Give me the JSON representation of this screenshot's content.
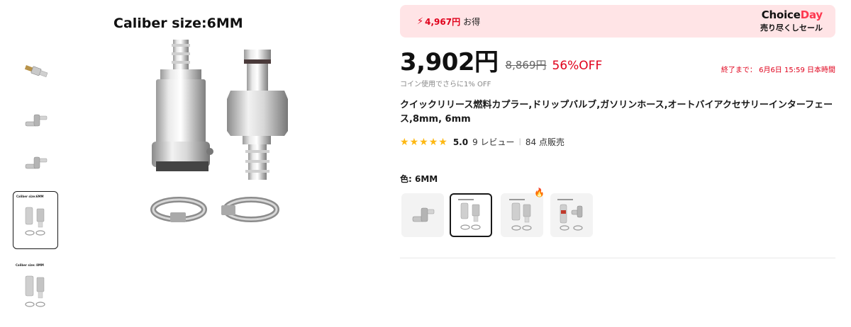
{
  "gallery": {
    "main_caption": "Caliber size:6MM",
    "thumbnails": [
      {
        "icon": "straight-fitting-icon"
      },
      {
        "icon": "elbow-fitting-icon"
      },
      {
        "icon": "elbow-fitting-icon"
      },
      {
        "icon": "coupler-set-icon",
        "caption": "Caliber size:6MM",
        "active": true
      },
      {
        "icon": "coupler-set-icon",
        "caption": "Caliber size: 8MM"
      }
    ]
  },
  "banner": {
    "bolt": "⚡",
    "savings": "4,967円",
    "savings_label": "お得",
    "brand_choice": "Choice",
    "brand_day": "Day",
    "brand_tagline": "売り尽くしセール"
  },
  "pricing": {
    "price": "3,902円",
    "original_price": "8,869円",
    "discount": "56%OFF",
    "sale_end": "終了まで： 6月6日 15:59 日本時間",
    "coin_note": "コイン使用でさらに1% OFF"
  },
  "product": {
    "title": "クイックリリース燃料カプラー,ドリップバルブ,ガソリンホース,オートバイアクセサリーインターフェース,8mm, 6mm",
    "rating": {
      "stars": 5,
      "score": "5.0",
      "reviews": "9 レビュー",
      "separator": "|",
      "sold": "84 点販売"
    }
  },
  "variants": {
    "label": "色: 6MM",
    "options": [
      {
        "name": "elbow",
        "icon": "elbow-fitting-icon"
      },
      {
        "name": "6MM",
        "icon": "coupler-set-icon",
        "active": true
      },
      {
        "name": "8MM",
        "icon": "coupler-set-icon",
        "hot": true
      },
      {
        "name": "elbow-set",
        "icon": "elbow-set-icon"
      }
    ],
    "hot_icon": "🔥"
  },
  "colors": {
    "accent_red": "#e0001b",
    "banner_bg": "#ffe4e6",
    "star": "#fdb813",
    "choice_day": "#fd384f"
  }
}
